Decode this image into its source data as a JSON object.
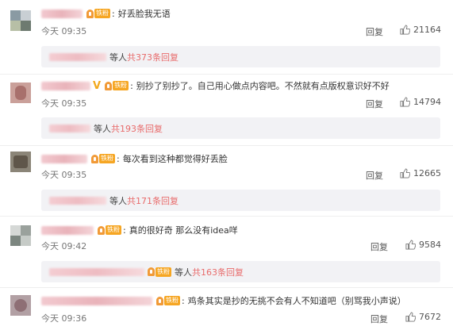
{
  "fan_badge": "铁粉",
  "comments": [
    {
      "text": "好丢脸我无语",
      "time": "今天 09:35",
      "reply_label": "回复",
      "likes": "21164",
      "replies_etal": "等人",
      "replies_count": "共373条回复"
    },
    {
      "text": "别抄了别抄了。自己用心做点内容吧。不然就有点版权意识好不好",
      "time": "今天 09:35",
      "reply_label": "回复",
      "likes": "14794",
      "replies_etal": "等人",
      "replies_count": "共193条回复"
    },
    {
      "text": "每次看到这种都觉得好丢脸",
      "time": "今天 09:35",
      "reply_label": "回复",
      "likes": "12665",
      "replies_etal": "等人",
      "replies_count": "共171条回复"
    },
    {
      "text": "真的很好奇 那么没有idea咩",
      "time": "今天 09:42",
      "reply_label": "回复",
      "likes": "9584",
      "replies_etal": "等人",
      "replies_count": "共163条回复"
    },
    {
      "text": "鸡条其实是抄的无挑不会有人不知道吧（别骂我小声说）",
      "time": "今天 09:36",
      "reply_label": "回复",
      "likes": "7672"
    }
  ]
}
